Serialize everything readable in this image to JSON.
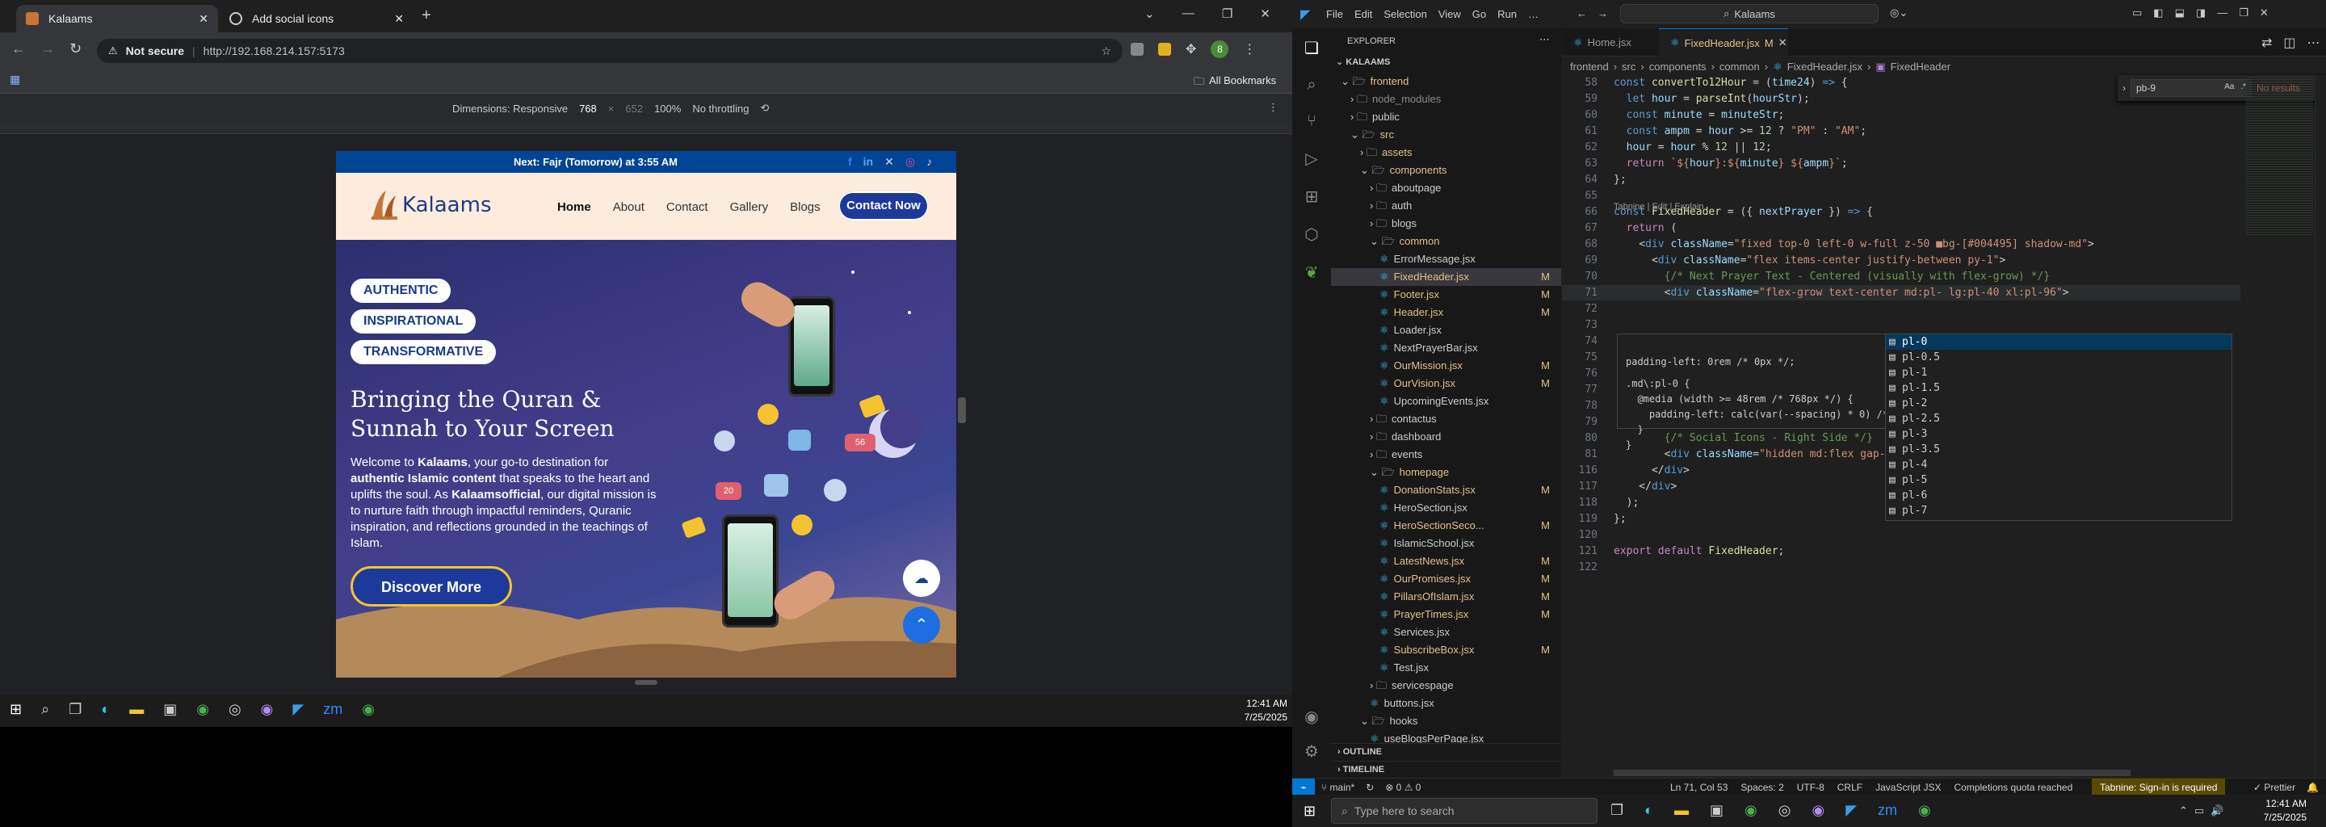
{
  "browser": {
    "tabs": [
      {
        "title": "Kalaams",
        "active": true
      },
      {
        "title": "Add social icons",
        "active": false
      }
    ],
    "security_label": "Not secure",
    "url": "http://192.168.214.157:5173",
    "bookmarks_label": "All Bookmarks",
    "profile_initial": "8",
    "devtools": {
      "dimensions_label": "Dimensions: Responsive",
      "width": "768",
      "times": "×",
      "height": "652",
      "zoom": "100%",
      "throttle": "No throttling"
    }
  },
  "site": {
    "prayer_bar": "Next: Fajr (Tomorrow) at 3:55 AM",
    "logo_text": "Kalaams",
    "nav": [
      "Home",
      "About",
      "Contact",
      "Gallery",
      "Blogs"
    ],
    "cta": "Contact Now",
    "pills": [
      "AUTHENTIC",
      "INSPIRATIONAL",
      "TRANSFORMATIVE"
    ],
    "heading_line1": "Bringing the Quran &",
    "heading_line2": "Sunnah to Your Screen",
    "para": {
      "p1": "Welcome to ",
      "b1": "Kalaams",
      "p2": ", your go-to destination for ",
      "b2": "authentic Islamic content",
      "p3": " that speaks to the heart and uplifts the soul. As ",
      "b3": "Kalaamsofficial",
      "p4": ", our digital mission is to nurture faith through impactful reminders, Quranic inspiration, and reflections grounded in the teachings of Islam."
    },
    "discover": "Discover More",
    "badges": {
      "likes": "20",
      "hearts": "56"
    }
  },
  "taskbar_left": {
    "time": "12:41 AM",
    "date": "7/25/2025"
  },
  "taskbar_right": {
    "search_placeholder": "Type here to search",
    "time": "12:41 AM",
    "date": "7/25/2025"
  },
  "vscode": {
    "menu": [
      "File",
      "Edit",
      "Selection",
      "View",
      "Go",
      "Run",
      "…"
    ],
    "search": "Kalaams",
    "explorer_title": "EXPLORER",
    "root": "KALAAMS",
    "tabs": [
      {
        "name": "Home.jsx",
        "active": false
      },
      {
        "name": "FixedHeader.jsx",
        "mark": "M",
        "active": true
      }
    ],
    "breadcrumb": [
      "frontend",
      "src",
      "components",
      "common",
      "FixedHeader.jsx",
      "FixedHeader"
    ],
    "find_query": "pb-9",
    "find_result": "No results",
    "tree": [
      {
        "label": "frontend",
        "depth": 1,
        "type": "folder-open",
        "color": "#e2c08d"
      },
      {
        "label": "node_modules",
        "depth": 2,
        "type": "folder",
        "color": "#8b8b8b"
      },
      {
        "label": "public",
        "depth": 2,
        "type": "folder"
      },
      {
        "label": "src",
        "depth": 2,
        "type": "folder-open",
        "color": "#e2c08d"
      },
      {
        "label": "assets",
        "depth": 3,
        "type": "folder",
        "color": "#e2c08d"
      },
      {
        "label": "components",
        "depth": 3,
        "type": "folder-open",
        "color": "#e2c08d"
      },
      {
        "label": "aboutpage",
        "depth": 4,
        "type": "folder"
      },
      {
        "label": "auth",
        "depth": 4,
        "type": "folder"
      },
      {
        "label": "blogs",
        "depth": 4,
        "type": "folder"
      },
      {
        "label": "common",
        "depth": 4,
        "type": "folder-open",
        "color": "#e2c08d"
      },
      {
        "label": "ErrorMessage.jsx",
        "depth": 5,
        "type": "file"
      },
      {
        "label": "FixedHeader.jsx",
        "depth": 5,
        "type": "file",
        "badge": "M",
        "color": "#e2c08d",
        "selected": true
      },
      {
        "label": "Footer.jsx",
        "depth": 5,
        "type": "file",
        "badge": "M",
        "color": "#e2c08d"
      },
      {
        "label": "Header.jsx",
        "depth": 5,
        "type": "file",
        "badge": "M",
        "color": "#e2c08d"
      },
      {
        "label": "Loader.jsx",
        "depth": 5,
        "type": "file"
      },
      {
        "label": "NextPrayerBar.jsx",
        "depth": 5,
        "type": "file"
      },
      {
        "label": "OurMission.jsx",
        "depth": 5,
        "type": "file",
        "badge": "M",
        "color": "#e2c08d"
      },
      {
        "label": "OurVision.jsx",
        "depth": 5,
        "type": "file",
        "badge": "M",
        "color": "#e2c08d"
      },
      {
        "label": "UpcomingEvents.jsx",
        "depth": 5,
        "type": "file"
      },
      {
        "label": "contactus",
        "depth": 4,
        "type": "folder"
      },
      {
        "label": "dashboard",
        "depth": 4,
        "type": "folder"
      },
      {
        "label": "events",
        "depth": 4,
        "type": "folder"
      },
      {
        "label": "homepage",
        "depth": 4,
        "type": "folder-open",
        "color": "#e2c08d"
      },
      {
        "label": "DonationStats.jsx",
        "depth": 5,
        "type": "file",
        "badge": "M",
        "color": "#e2c08d"
      },
      {
        "label": "HeroSection.jsx",
        "depth": 5,
        "type": "file"
      },
      {
        "label": "HeroSectionSeco...",
        "depth": 5,
        "type": "file",
        "badge": "M",
        "color": "#e2c08d"
      },
      {
        "label": "IslamicSchool.jsx",
        "depth": 5,
        "type": "file"
      },
      {
        "label": "LatestNews.jsx",
        "depth": 5,
        "type": "file",
        "badge": "M",
        "color": "#e2c08d"
      },
      {
        "label": "OurPromises.jsx",
        "depth": 5,
        "type": "file",
        "badge": "M",
        "color": "#e2c08d"
      },
      {
        "label": "PillarsOfIslam.jsx",
        "depth": 5,
        "type": "file",
        "badge": "M",
        "color": "#e2c08d"
      },
      {
        "label": "PrayerTimes.jsx",
        "depth": 5,
        "type": "file",
        "badge": "M",
        "color": "#e2c08d"
      },
      {
        "label": "Services.jsx",
        "depth": 5,
        "type": "file"
      },
      {
        "label": "SubscribeBox.jsx",
        "depth": 5,
        "type": "file",
        "badge": "M",
        "color": "#e2c08d"
      },
      {
        "label": "Test.jsx",
        "depth": 5,
        "type": "file"
      },
      {
        "label": "servicespage",
        "depth": 4,
        "type": "folder"
      },
      {
        "label": "buttons.jsx",
        "depth": 4,
        "type": "file"
      },
      {
        "label": "hooks",
        "depth": 3,
        "type": "folder-open"
      },
      {
        "label": "useBlogsPerPage.jsx",
        "depth": 4,
        "type": "file"
      }
    ],
    "outline_label": "OUTLINE",
    "timeline_label": "TIMELINE",
    "code_lines": [
      {
        "n": "58",
        "html": "<span class='kw'>const</span> <span class='fn'>convertTo12Hour</span> = (<span class='vr'>time24</span>) <span class='kw'>=&gt;</span> {"
      },
      {
        "n": "59",
        "html": "  <span class='kw'>let</span> <span class='vr'>hour</span> = <span class='fn'>parseInt</span>(<span class='vr'>hourStr</span>);"
      },
      {
        "n": "60",
        "html": "  <span class='kw'>const</span> <span class='vr'>minute</span> = <span class='vr'>minuteStr</span>;"
      },
      {
        "n": "61",
        "html": "  <span class='kw'>const</span> <span class='vr'>ampm</span> = <span class='vr'>hour</span> &gt;= <span class='nm'>12</span> ? <span class='str'>\"PM\"</span> : <span class='str'>\"AM\"</span>;"
      },
      {
        "n": "62",
        "html": "  <span class='vr'>hour</span> = <span class='vr'>hour</span> % <span class='nm'>12</span> || <span class='nm'>12</span>;"
      },
      {
        "n": "63",
        "html": "  <span class='kw2'>return</span> <span class='str'>`${</span><span class='vr'>hour</span><span class='str'>}:${</span><span class='vr'>minute</span><span class='str'>} ${</span><span class='vr'>ampm</span><span class='str'>}`</span>;"
      },
      {
        "n": "64",
        "html": "};"
      },
      {
        "n": "65",
        "html": ""
      },
      {
        "n": "66",
        "html": "<span class='kw'>const</span> <span class='fn'>FixedHeader</span> = ({ <span class='vr'>nextPrayer</span> }) <span class='kw'>=&gt;</span> {"
      },
      {
        "n": "67",
        "html": "  <span class='kw2'>return</span> ("
      },
      {
        "n": "68",
        "html": "    &lt;<span class='tg'>div</span> <span class='at'>className</span>=<span class='str'>\"fixed top-0 left-0 w-full z-50 ■bg-[#004495] shadow-md\"</span>&gt;"
      },
      {
        "n": "69",
        "html": "      &lt;<span class='tg'>div</span> <span class='at'>className</span>=<span class='str'>\"flex items-center justify-between py-1\"</span>&gt;"
      },
      {
        "n": "70",
        "html": "        <span class='cm'>{/* Next Prayer Text - Centered (visually with flex-grow) */}</span>"
      },
      {
        "n": "71",
        "html": "        &lt;<span class='tg'>div</span> <span class='at'>className</span>=<span class='str'>\"flex-grow text-center md:pl- lg:pl-40 xl:pl-96\"</span>&gt;"
      },
      {
        "n": "72",
        "html": ""
      },
      {
        "n": "73",
        "html": ""
      },
      {
        "n": "74",
        "html": ""
      },
      {
        "n": "75",
        "html": ""
      },
      {
        "n": "76",
        "html": ""
      },
      {
        "n": "77",
        "html": ""
      },
      {
        "n": "78",
        "html": "          <span class='tg'>}</span>"
      },
      {
        "n": "79",
        "html": "        &lt;/<span class='tg'>div</span>&gt;"
      },
      {
        "n": "80",
        "html": "        <span class='cm'>{/* Social Icons - Right Side */}</span>"
      },
      {
        "n": "81",
        "html": "        &lt;<span class='tg'>div</span> <span class='at'>className</span>=<span class='str'>\"hidden md:flex gap-4 text-sm</span>"
      },
      {
        "n": "116",
        "html": "      &lt;/<span class='tg'>div</span>&gt;"
      },
      {
        "n": "117",
        "html": "    &lt;/<span class='tg'>div</span>&gt;"
      },
      {
        "n": "118",
        "html": "  );"
      },
      {
        "n": "119",
        "html": "};"
      },
      {
        "n": "120",
        "html": ""
      },
      {
        "n": "121",
        "html": "<span class='kw2'>export</span> <span class='kw2'>default</span> <span class='fn'>FixedHeader</span>;"
      },
      {
        "n": "122",
        "html": ""
      }
    ],
    "codelens": "Tabnine | Edit | Explain",
    "hover": {
      "line1": "padding-left: 0rem /* 0px */;",
      "line2": ".md\\:pl-0 {",
      "line3": "  @media (width >= 48rem /* 768px */) {",
      "line4": "    padding-left: calc(var(--spacing) * 0) /* 0px */;",
      "line5": "  }",
      "line6": "}"
    },
    "suggestions": [
      "pl-0",
      "pl-0.5",
      "pl-1",
      "pl-1.5",
      "pl-2",
      "pl-2.5",
      "pl-3",
      "pl-3.5",
      "pl-4",
      "pl-5",
      "pl-6",
      "pl-7"
    ],
    "status": {
      "branch": "main*",
      "errors": "⊗ 0 ⚠ 0",
      "position": "Ln 71, Col 53",
      "spaces": "Spaces: 2",
      "encoding": "UTF-8",
      "eol": "CRLF",
      "language": "JavaScript JSX",
      "quota": "Completions quota reached",
      "tabnine": "Tabnine: Sign-in is required",
      "prettier": "✓ Prettier"
    }
  }
}
